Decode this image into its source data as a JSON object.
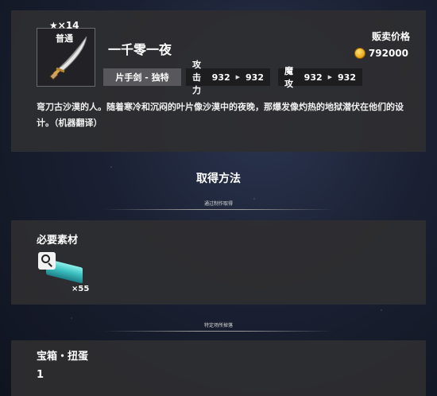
{
  "item": {
    "stars": "★×14",
    "rarity": "普通",
    "name": "一千零一夜",
    "sell_label": "贩卖价格",
    "sell_price": "792000",
    "weapon_type": "片手剑 - 独特",
    "attack_label": "攻击力",
    "attack_from": "932",
    "attack_to": "932",
    "magic_label": "魔攻",
    "magic_from": "932",
    "magic_to": "932",
    "description": "弯刀古沙漠的人。随着寒冷和沉闷的叶片像沙漠中的夜晚，那爆发像灼热的地狱潜伏在他们的设计。（机器翻译）"
  },
  "acquire": {
    "title": "取得方法",
    "craft_subhead": "通过制作取得",
    "location_subhead": "特定场所掉落"
  },
  "materials": {
    "title": "必要素材",
    "items": [
      {
        "icon": "teal-ingot-icon",
        "count": "×55"
      }
    ]
  },
  "location": {
    "name": "宝箱・扭蛋",
    "count": "1"
  },
  "colors": {
    "panel": "#2e2e30",
    "tag": "#1d1d20",
    "coin": "#e7a512",
    "material": "#3fc4c4"
  }
}
